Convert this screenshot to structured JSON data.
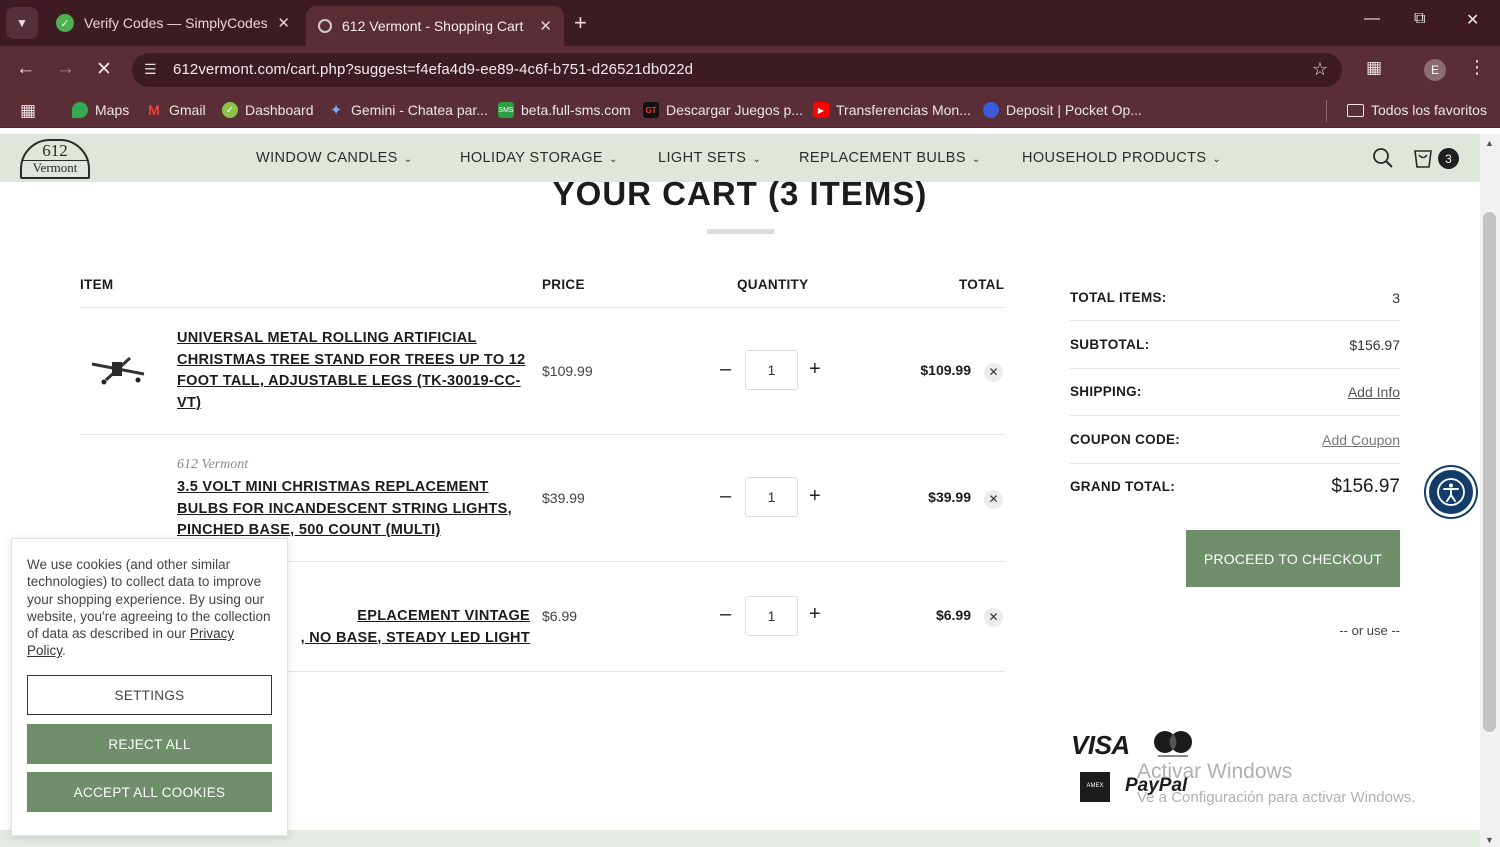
{
  "browser": {
    "tabs": [
      {
        "title": "Verify Codes — SimplyCodes",
        "active": false
      },
      {
        "title": "612 Vermont - Shopping Cart",
        "active": true
      }
    ],
    "url": "612vermont.com/cart.php?suggest=f4efa4d9-ee89-4c6f-b751-d26521db022d",
    "profile_initial": "E",
    "bookmarks": [
      "Maps",
      "Gmail",
      "Dashboard",
      "Gemini - Chatea par...",
      "beta.full-sms.com",
      "Descargar Juegos p...",
      "Transferencias Mon...",
      "Deposit | Pocket Op...",
      "Todos los favoritos"
    ]
  },
  "site": {
    "logo": {
      "line1": "612",
      "line2": "Vermont"
    },
    "nav": [
      "WINDOW CANDLES",
      "HOLIDAY STORAGE",
      "LIGHT SETS",
      "REPLACEMENT BULBS",
      "HOUSEHOLD PRODUCTS"
    ],
    "cart_count": "3"
  },
  "cart": {
    "title": "YOUR CART (3 ITEMS)",
    "headers": {
      "item": "ITEM",
      "price": "PRICE",
      "quantity": "QUANTITY",
      "total": "TOTAL"
    },
    "items": [
      {
        "brand": "",
        "name": "UNIVERSAL METAL ROLLING ARTIFICIAL CHRISTMAS TREE STAND FOR TREES UP TO 12 FOOT TALL, ADJUSTABLE LEGS (TK-30019-CC-VT)",
        "price": "$109.99",
        "qty": "1",
        "total": "$109.99"
      },
      {
        "brand": "612 Vermont",
        "name": "3.5 VOLT MINI CHRISTMAS REPLACEMENT BULBS FOR INCANDESCENT STRING LIGHTS, PINCHED BASE, 500 COUNT (MULTI)",
        "price": "$39.99",
        "qty": "1",
        "total": "$39.99"
      },
      {
        "brand": "",
        "name": "EPLACEMENT VINTAGE\n, NO BASE, STEADY LED LIGHT",
        "price": "$6.99",
        "qty": "1",
        "total": "$6.99"
      }
    ]
  },
  "summary": {
    "total_items_label": "TOTAL ITEMS:",
    "total_items": "3",
    "subtotal_label": "SUBTOTAL:",
    "subtotal": "$156.97",
    "shipping_label": "SHIPPING:",
    "shipping": "Add Info",
    "coupon_label": "COUPON CODE:",
    "coupon": "Add Coupon",
    "grand_label": "GRAND TOTAL:",
    "grand": "$156.97",
    "checkout": "PROCEED TO CHECKOUT",
    "or_use": "-- or use --",
    "payments": {
      "visa": "VISA",
      "paypal": "PayPal"
    }
  },
  "cookie": {
    "text": "We use cookies (and other similar technologies) to collect data to improve your shopping experience. By using our website, you're agreeing to the collection of data as described in our ",
    "policy_link": "Privacy Policy",
    "settings": "SETTINGS",
    "reject": "REJECT ALL",
    "accept": "ACCEPT ALL COOKIES"
  },
  "watermark": {
    "line1": "Activar Windows",
    "line2": "Ve a Configuración para activar Windows."
  },
  "colors": {
    "brand_green": "#6f8f6b",
    "nav_bg": "#dfe6dc",
    "chrome_dark": "#3c1c22",
    "chrome_mid": "#5a2e37",
    "a11y_blue": "#123d68"
  }
}
